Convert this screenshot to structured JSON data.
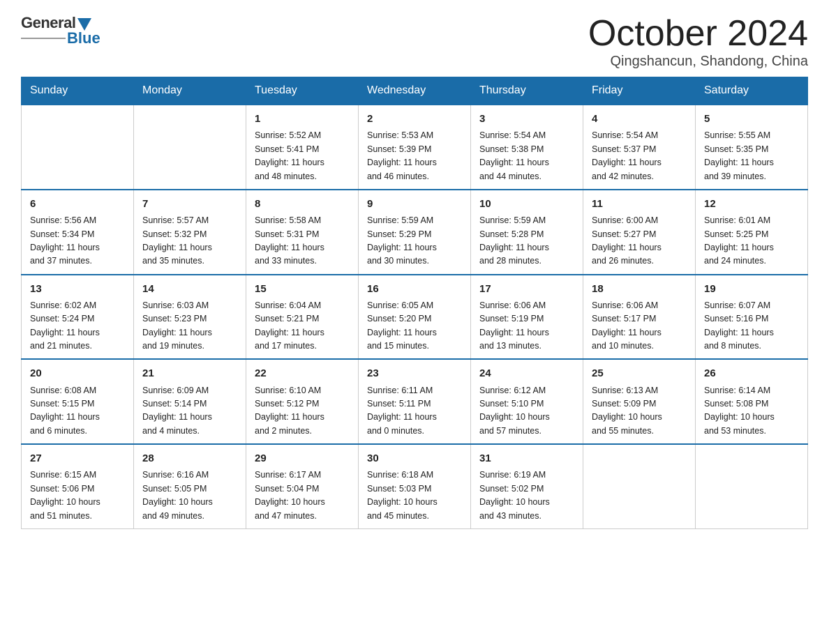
{
  "header": {
    "logo_general": "General",
    "logo_blue": "Blue",
    "month_title": "October 2024",
    "location": "Qingshancun, Shandong, China"
  },
  "weekdays": [
    "Sunday",
    "Monday",
    "Tuesday",
    "Wednesday",
    "Thursday",
    "Friday",
    "Saturday"
  ],
  "weeks": [
    [
      {
        "day": "",
        "info": ""
      },
      {
        "day": "",
        "info": ""
      },
      {
        "day": "1",
        "info": "Sunrise: 5:52 AM\nSunset: 5:41 PM\nDaylight: 11 hours\nand 48 minutes."
      },
      {
        "day": "2",
        "info": "Sunrise: 5:53 AM\nSunset: 5:39 PM\nDaylight: 11 hours\nand 46 minutes."
      },
      {
        "day": "3",
        "info": "Sunrise: 5:54 AM\nSunset: 5:38 PM\nDaylight: 11 hours\nand 44 minutes."
      },
      {
        "day": "4",
        "info": "Sunrise: 5:54 AM\nSunset: 5:37 PM\nDaylight: 11 hours\nand 42 minutes."
      },
      {
        "day": "5",
        "info": "Sunrise: 5:55 AM\nSunset: 5:35 PM\nDaylight: 11 hours\nand 39 minutes."
      }
    ],
    [
      {
        "day": "6",
        "info": "Sunrise: 5:56 AM\nSunset: 5:34 PM\nDaylight: 11 hours\nand 37 minutes."
      },
      {
        "day": "7",
        "info": "Sunrise: 5:57 AM\nSunset: 5:32 PM\nDaylight: 11 hours\nand 35 minutes."
      },
      {
        "day": "8",
        "info": "Sunrise: 5:58 AM\nSunset: 5:31 PM\nDaylight: 11 hours\nand 33 minutes."
      },
      {
        "day": "9",
        "info": "Sunrise: 5:59 AM\nSunset: 5:29 PM\nDaylight: 11 hours\nand 30 minutes."
      },
      {
        "day": "10",
        "info": "Sunrise: 5:59 AM\nSunset: 5:28 PM\nDaylight: 11 hours\nand 28 minutes."
      },
      {
        "day": "11",
        "info": "Sunrise: 6:00 AM\nSunset: 5:27 PM\nDaylight: 11 hours\nand 26 minutes."
      },
      {
        "day": "12",
        "info": "Sunrise: 6:01 AM\nSunset: 5:25 PM\nDaylight: 11 hours\nand 24 minutes."
      }
    ],
    [
      {
        "day": "13",
        "info": "Sunrise: 6:02 AM\nSunset: 5:24 PM\nDaylight: 11 hours\nand 21 minutes."
      },
      {
        "day": "14",
        "info": "Sunrise: 6:03 AM\nSunset: 5:23 PM\nDaylight: 11 hours\nand 19 minutes."
      },
      {
        "day": "15",
        "info": "Sunrise: 6:04 AM\nSunset: 5:21 PM\nDaylight: 11 hours\nand 17 minutes."
      },
      {
        "day": "16",
        "info": "Sunrise: 6:05 AM\nSunset: 5:20 PM\nDaylight: 11 hours\nand 15 minutes."
      },
      {
        "day": "17",
        "info": "Sunrise: 6:06 AM\nSunset: 5:19 PM\nDaylight: 11 hours\nand 13 minutes."
      },
      {
        "day": "18",
        "info": "Sunrise: 6:06 AM\nSunset: 5:17 PM\nDaylight: 11 hours\nand 10 minutes."
      },
      {
        "day": "19",
        "info": "Sunrise: 6:07 AM\nSunset: 5:16 PM\nDaylight: 11 hours\nand 8 minutes."
      }
    ],
    [
      {
        "day": "20",
        "info": "Sunrise: 6:08 AM\nSunset: 5:15 PM\nDaylight: 11 hours\nand 6 minutes."
      },
      {
        "day": "21",
        "info": "Sunrise: 6:09 AM\nSunset: 5:14 PM\nDaylight: 11 hours\nand 4 minutes."
      },
      {
        "day": "22",
        "info": "Sunrise: 6:10 AM\nSunset: 5:12 PM\nDaylight: 11 hours\nand 2 minutes."
      },
      {
        "day": "23",
        "info": "Sunrise: 6:11 AM\nSunset: 5:11 PM\nDaylight: 11 hours\nand 0 minutes."
      },
      {
        "day": "24",
        "info": "Sunrise: 6:12 AM\nSunset: 5:10 PM\nDaylight: 10 hours\nand 57 minutes."
      },
      {
        "day": "25",
        "info": "Sunrise: 6:13 AM\nSunset: 5:09 PM\nDaylight: 10 hours\nand 55 minutes."
      },
      {
        "day": "26",
        "info": "Sunrise: 6:14 AM\nSunset: 5:08 PM\nDaylight: 10 hours\nand 53 minutes."
      }
    ],
    [
      {
        "day": "27",
        "info": "Sunrise: 6:15 AM\nSunset: 5:06 PM\nDaylight: 10 hours\nand 51 minutes."
      },
      {
        "day": "28",
        "info": "Sunrise: 6:16 AM\nSunset: 5:05 PM\nDaylight: 10 hours\nand 49 minutes."
      },
      {
        "day": "29",
        "info": "Sunrise: 6:17 AM\nSunset: 5:04 PM\nDaylight: 10 hours\nand 47 minutes."
      },
      {
        "day": "30",
        "info": "Sunrise: 6:18 AM\nSunset: 5:03 PM\nDaylight: 10 hours\nand 45 minutes."
      },
      {
        "day": "31",
        "info": "Sunrise: 6:19 AM\nSunset: 5:02 PM\nDaylight: 10 hours\nand 43 minutes."
      },
      {
        "day": "",
        "info": ""
      },
      {
        "day": "",
        "info": ""
      }
    ]
  ]
}
